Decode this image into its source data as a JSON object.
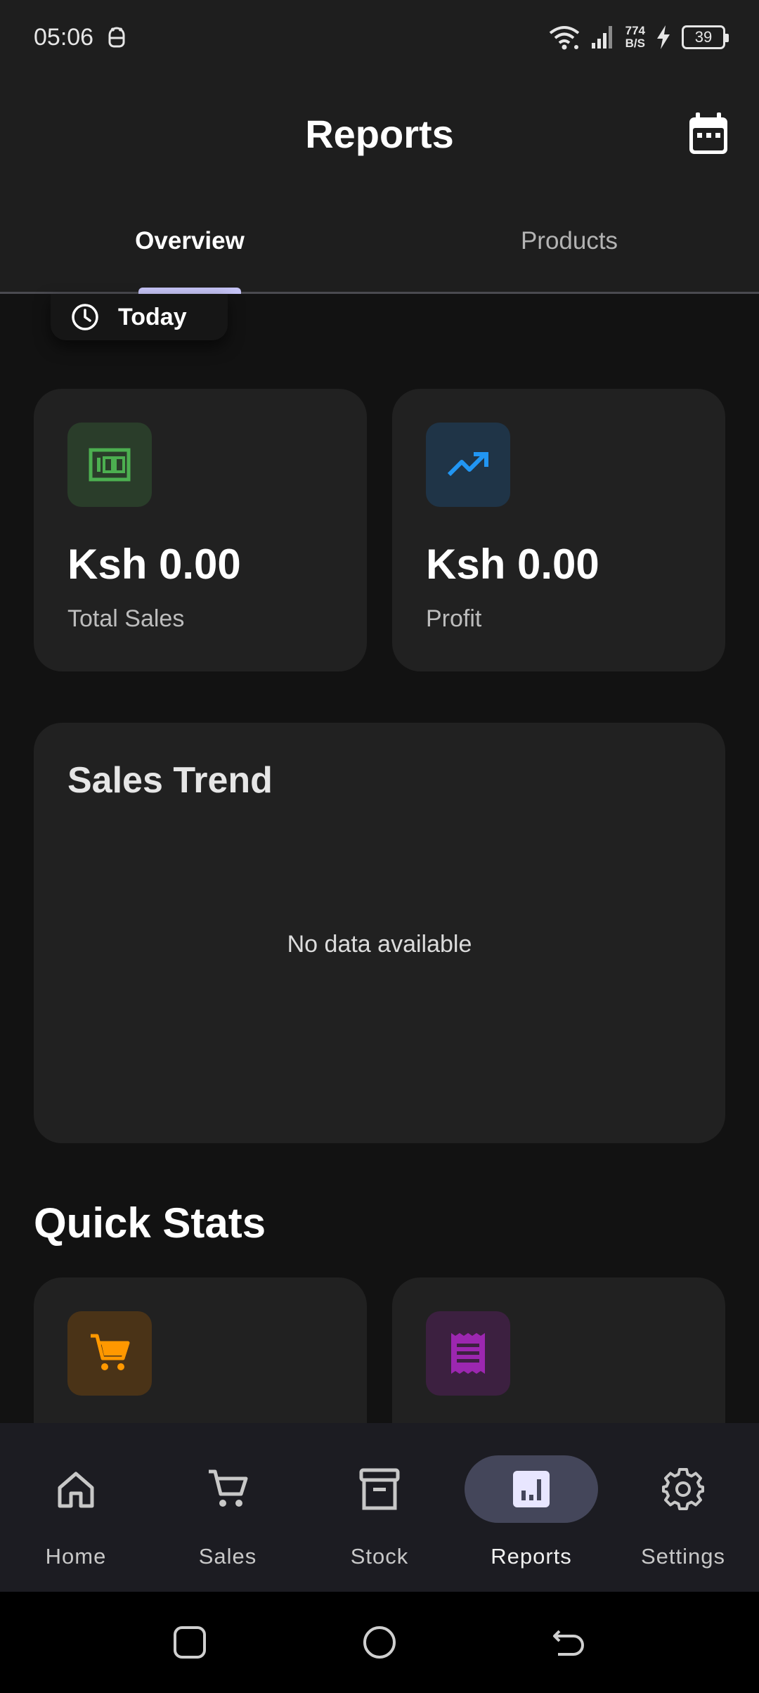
{
  "status_bar": {
    "time": "05:06",
    "speed_value": "774",
    "speed_unit": "B/S",
    "battery": "39",
    "icons": [
      "android-debug-icon",
      "wifi-icon",
      "signal-icon",
      "charging-icon",
      "battery-icon"
    ]
  },
  "app_bar": {
    "title": "Reports",
    "calendar_icon": "calendar-icon"
  },
  "tabs": [
    {
      "label": "Overview",
      "selected": true
    },
    {
      "label": "Products",
      "selected": false
    }
  ],
  "filter": {
    "label": "Today",
    "icon": "clock-icon"
  },
  "summary_cards": [
    {
      "value": "Ksh 0.00",
      "label": "Total Sales",
      "icon": "money-icon",
      "color": "#4caf50"
    },
    {
      "value": "Ksh 0.00",
      "label": "Profit",
      "icon": "trending-up-icon",
      "color": "#2196f3"
    }
  ],
  "sales_trend": {
    "title": "Sales Trend",
    "empty_message": "No data available"
  },
  "quick_stats": {
    "title": "Quick Stats",
    "cards": [
      {
        "icon": "cart-icon",
        "color": "#ff9800"
      },
      {
        "icon": "receipt-icon",
        "color": "#9c27b0"
      }
    ]
  },
  "bottom_nav": [
    {
      "label": "Home",
      "icon": "home-icon",
      "active": false
    },
    {
      "label": "Sales",
      "icon": "cart-icon",
      "active": false
    },
    {
      "label": "Stock",
      "icon": "archive-icon",
      "active": false
    },
    {
      "label": "Reports",
      "icon": "bar-chart-icon",
      "active": true
    },
    {
      "label": "Settings",
      "icon": "gear-icon",
      "active": false
    }
  ],
  "system_nav": [
    "recents-button",
    "home-button",
    "back-button"
  ]
}
